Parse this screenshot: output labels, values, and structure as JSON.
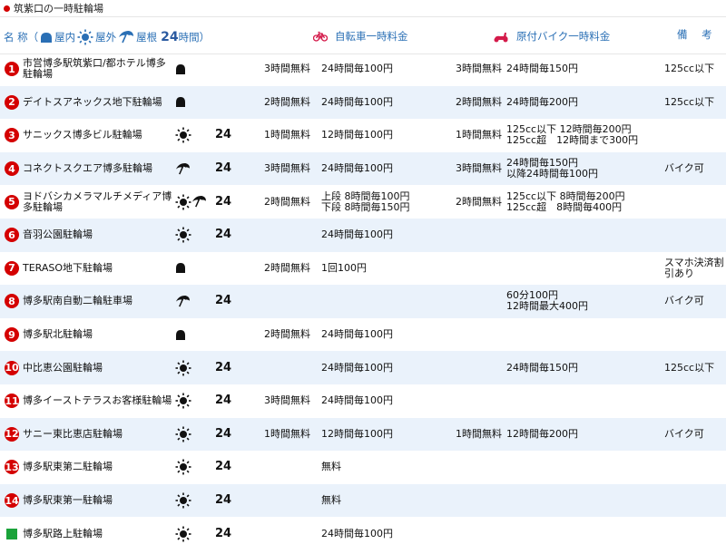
{
  "page_title": "筑紫口の一時駐輪場",
  "header": {
    "name_prefix": "名 称（",
    "indoor": "屋内",
    "outdoor": "屋外",
    "roof": "屋根",
    "h24": "24",
    "hours": "時間）",
    "bicycle": "自転車一時料金",
    "moped": "原付バイク一時料金",
    "note": "備 考"
  },
  "rows": [
    {
      "no": "1",
      "name": "市営博多駅筑紫口/都ホテル博多駐輪場",
      "icons": [
        "indoor"
      ],
      "h24": "",
      "bfree": "3時間無料",
      "bprice": "24時間毎100円",
      "mfree": "3時間無料",
      "mprice": "24時間毎150円",
      "note": "125cc以下"
    },
    {
      "no": "2",
      "name": "デイトスアネックス地下駐輪場",
      "icons": [
        "indoor"
      ],
      "h24": "",
      "bfree": "2時間無料",
      "bprice": "24時間毎100円",
      "mfree": "2時間無料",
      "mprice": "24時間毎200円",
      "note": "125cc以下"
    },
    {
      "no": "3",
      "name": "サニックス博多ビル駐輪場",
      "icons": [
        "outdoor"
      ],
      "h24": "24",
      "bfree": "1時間無料",
      "bprice": "12時間毎100円",
      "mfree": "1時間無料",
      "mprice": "125cc以下 12時間毎200円\n125cc超　12時間まで300円",
      "note": ""
    },
    {
      "no": "4",
      "name": "コネクトスクエア博多駐輪場",
      "icons": [
        "roof"
      ],
      "h24": "24",
      "bfree": "3時間無料",
      "bprice": "24時間毎100円",
      "mfree": "3時間無料",
      "mprice": "24時間毎150円\n以降24時間毎100円",
      "note": "バイク可"
    },
    {
      "no": "5",
      "name": "ヨドバシカメラマルチメディア博多駐輪場",
      "icons": [
        "outdoor",
        "roof"
      ],
      "h24": "24",
      "bfree": "2時間無料",
      "bprice": "上段 8時間毎100円\n下段 8時間毎150円",
      "mfree": "2時間無料",
      "mprice": "125cc以下 8時間毎200円\n125cc超　8時間毎400円",
      "note": ""
    },
    {
      "no": "6",
      "name": "音羽公園駐輪場",
      "icons": [
        "outdoor"
      ],
      "h24": "24",
      "bfree": "",
      "bprice": "24時間毎100円",
      "mfree": "",
      "mprice": "",
      "note": ""
    },
    {
      "no": "7",
      "name": "TERASO地下駐輪場",
      "icons": [
        "indoor"
      ],
      "h24": "",
      "bfree": "2時間無料",
      "bprice": "1回100円",
      "mfree": "",
      "mprice": "",
      "note": "スマホ決済割引あり"
    },
    {
      "no": "8",
      "name": "博多駅南自動二輪駐車場",
      "icons": [
        "roof"
      ],
      "h24": "24",
      "bfree": "",
      "bprice": "",
      "mfree": "",
      "mprice": "60分100円\n12時間最大400円",
      "note": "バイク可"
    },
    {
      "no": "9",
      "name": "博多駅北駐輪場",
      "icons": [
        "indoor"
      ],
      "h24": "",
      "bfree": "2時間無料",
      "bprice": "24時間毎100円",
      "mfree": "",
      "mprice": "",
      "note": ""
    },
    {
      "no": "10",
      "name": "中比恵公園駐輪場",
      "icons": [
        "outdoor"
      ],
      "h24": "24",
      "bfree": "",
      "bprice": "24時間毎100円",
      "mfree": "",
      "mprice": "24時間毎150円",
      "note": "125cc以下"
    },
    {
      "no": "11",
      "name": "博多イーストテラスお客様駐輪場",
      "icons": [
        "outdoor"
      ],
      "h24": "24",
      "bfree": "3時間無料",
      "bprice": "24時間毎100円",
      "mfree": "",
      "mprice": "",
      "note": ""
    },
    {
      "no": "12",
      "name": "サニー東比恵店駐輪場",
      "icons": [
        "outdoor"
      ],
      "h24": "24",
      "bfree": "1時間無料",
      "bprice": "12時間毎100円",
      "mfree": "1時間無料",
      "mprice": "12時間毎200円",
      "note": "バイク可"
    },
    {
      "no": "13",
      "name": "博多駅東第二駐輪場",
      "icons": [
        "outdoor"
      ],
      "h24": "24",
      "bfree": "",
      "bprice": "無料",
      "mfree": "",
      "mprice": "",
      "note": ""
    },
    {
      "no": "14",
      "name": "博多駅東第一駐輪場",
      "icons": [
        "outdoor"
      ],
      "h24": "24",
      "bfree": "",
      "bprice": "無料",
      "mfree": "",
      "mprice": "",
      "note": ""
    },
    {
      "no": "",
      "name": "博多駅路上駐輪場",
      "icons": [
        "outdoor"
      ],
      "h24": "24",
      "bfree": "",
      "bprice": "24時間毎100円",
      "mfree": "",
      "mprice": "",
      "note": "",
      "square": true
    }
  ]
}
